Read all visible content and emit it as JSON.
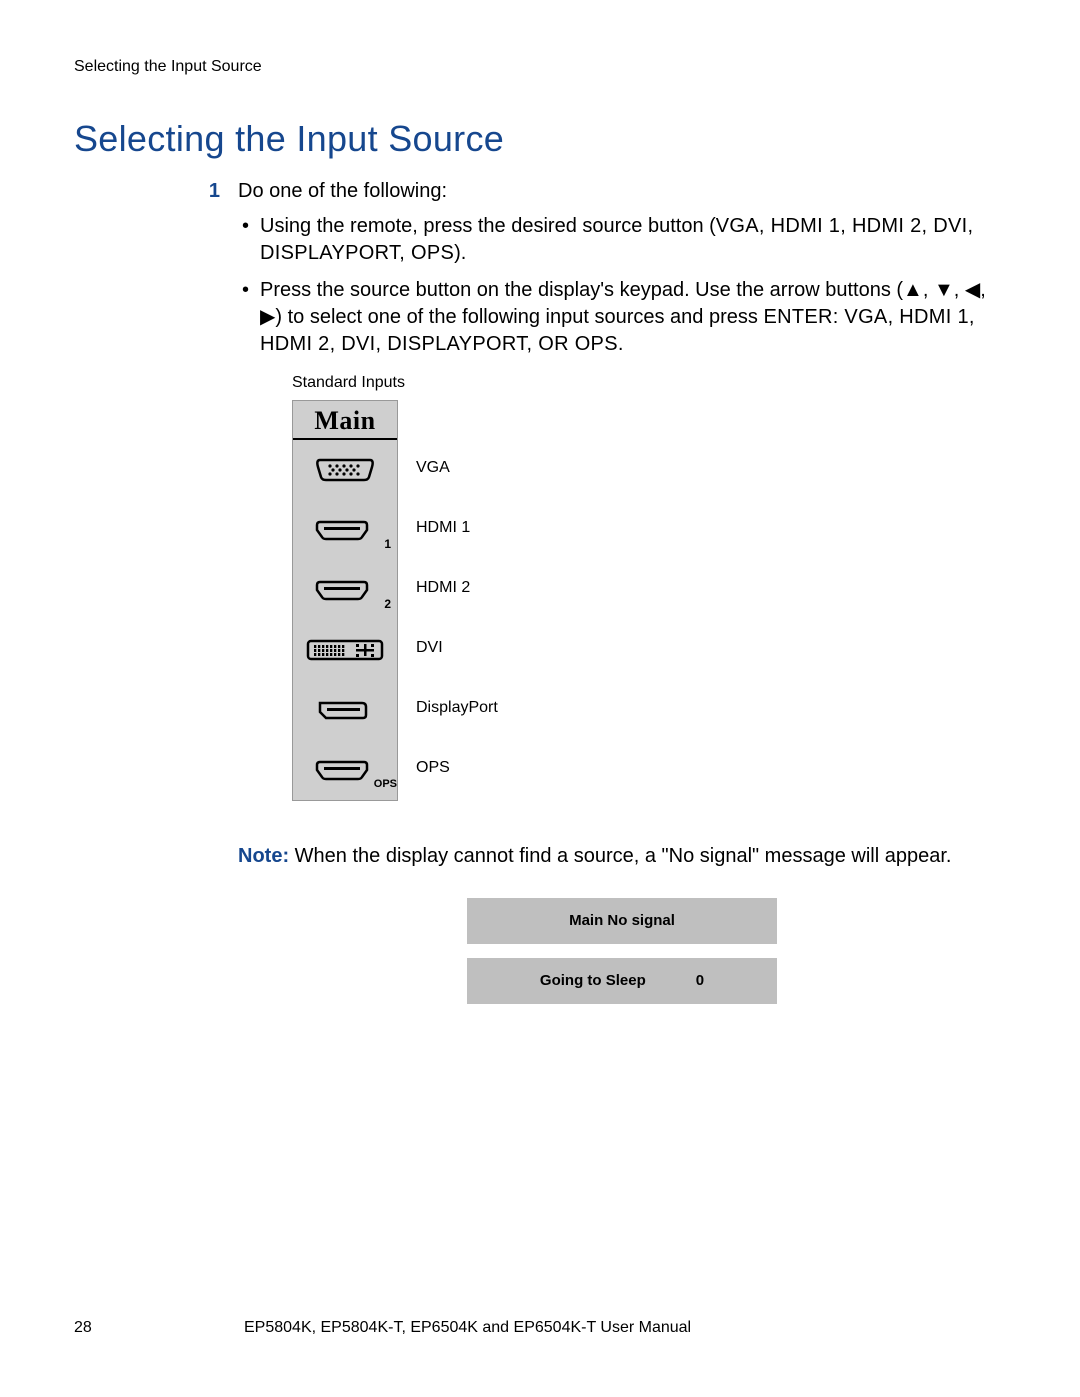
{
  "header": {
    "running_head": "Selecting the Input Source"
  },
  "title": "Selecting the Input Source",
  "step": {
    "number": "1",
    "lead": "Do one of the following:",
    "bullets": [
      {
        "pre": "Using the remote, press the desired source button (",
        "caps": "VGA, HDMI 1, HDMI 2, DVI, DISPLAYPORT, OPS",
        "post": ")."
      },
      {
        "pre": "Press the source button on the display's keypad. Use the arrow buttons (▲, ▼, ◀, ▶) to select one of the following input sources and press ",
        "caps": "ENTER: VGA, HDMI 1, HDMI 2, DVI, DISPLAYPORT, OR OPS",
        "post": "."
      }
    ]
  },
  "osd": {
    "caption": "Standard Inputs",
    "title": "Main",
    "items": [
      {
        "icon": "vga",
        "label": "VGA"
      },
      {
        "icon": "hdmi",
        "sub": "1",
        "label": "HDMI 1"
      },
      {
        "icon": "hdmi",
        "sub": "2",
        "label": "HDMI 2"
      },
      {
        "icon": "dvi",
        "label": "DVI"
      },
      {
        "icon": "dp",
        "label": "DisplayPort"
      },
      {
        "icon": "hdmi",
        "sub": "OPS",
        "label": "OPS"
      }
    ]
  },
  "note": {
    "label": "Note:",
    "text": " When the display cannot find a source, a \"No signal\" message will appear."
  },
  "no_signal": {
    "line1": "Main No signal",
    "line2_text": "Going to Sleep",
    "line2_value": "0"
  },
  "footer": {
    "page_number": "28",
    "text": "EP5804K, EP5804K-T, EP6504K and EP6504K-T User Manual"
  }
}
